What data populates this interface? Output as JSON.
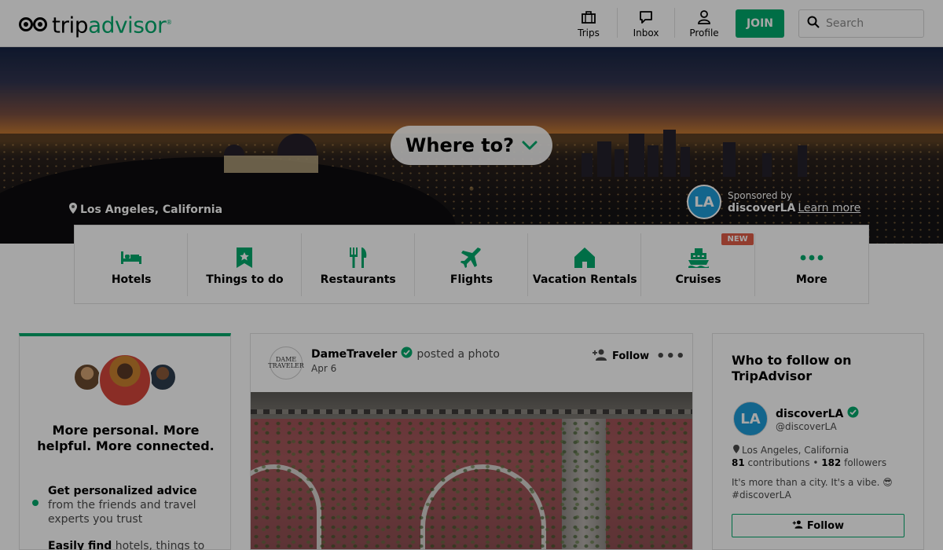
{
  "header": {
    "brand_first": "trip",
    "brand_second": "advisor",
    "brand_reg": "®",
    "nav": [
      {
        "label": "Trips",
        "icon": "briefcase-icon"
      },
      {
        "label": "Inbox",
        "icon": "chat-bubble-icon"
      },
      {
        "label": "Profile",
        "icon": "person-icon"
      }
    ],
    "join_label": "JOIN",
    "search_placeholder": "Search"
  },
  "hero": {
    "where_to": "Where to?",
    "location": "Los Angeles, California",
    "sponsored_label": "Sponsored by",
    "sponsor_name": "discoverLA",
    "learn_more": "Learn more",
    "sponsor_avatar_text": "LA"
  },
  "categories": [
    {
      "label": "Hotels",
      "icon": "bed-icon"
    },
    {
      "label": "Things to do",
      "icon": "ticket-icon"
    },
    {
      "label": "Restaurants",
      "icon": "fork-knife-icon"
    },
    {
      "label": "Flights",
      "icon": "airplane-icon"
    },
    {
      "label": "Vacation Rentals",
      "icon": "house-icon"
    },
    {
      "label": "Cruises",
      "icon": "ship-icon",
      "badge": "NEW"
    },
    {
      "label": "More",
      "icon": "more-dots-icon"
    }
  ],
  "left_card": {
    "title": "More personal. More helpful. More connected.",
    "benefits": [
      {
        "bold": "Get personalized advice",
        "rest": " from the friends and travel experts you trust"
      },
      {
        "bold": "Easily find",
        "rest": " hotels, things to"
      }
    ]
  },
  "feed": {
    "author": "DameTraveler",
    "action": "posted a photo",
    "date": "Apr 6",
    "avatar_text": "DAME TRAVELER",
    "follow_label": "Follow",
    "more": "•••"
  },
  "right_card": {
    "title": "Who to follow on TripAdvisor",
    "avatar_text": "LA",
    "name": "discoverLA",
    "handle": "@discoverLA",
    "location": "Los Angeles, California",
    "contributions": "81",
    "contributions_label": "contributions",
    "followers": "182",
    "followers_label": "followers",
    "bio": "It's more than a city. It's a vibe. 😎 #discoverLA",
    "follow_label": "Follow"
  },
  "colors": {
    "brand_green": "#00aa6c",
    "category_icon": "#00aa6c",
    "badge_red": "#e05c48",
    "verified": "#00aa6c"
  }
}
